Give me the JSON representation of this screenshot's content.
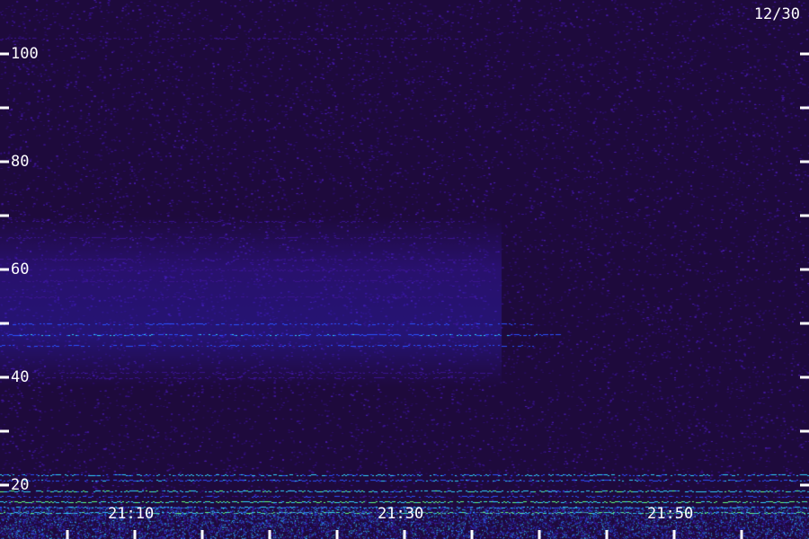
{
  "date_label": "12/30",
  "chart_data": {
    "type": "heatmap",
    "title": "",
    "xlabel": "",
    "ylabel": "",
    "x_ticks": [
      "21:10",
      "21:30",
      "21:50"
    ],
    "y_ticks": [
      20,
      40,
      60,
      80,
      100
    ],
    "y_minor_ticks": [
      30,
      50,
      70,
      90
    ],
    "ylim": [
      14,
      107
    ],
    "xlim": [
      "21:00",
      "22:00"
    ],
    "bands": [
      {
        "y": 103,
        "intensity": 0.35
      },
      {
        "y": 69,
        "intensity": 0.35
      },
      {
        "y": 66,
        "intensity": 0.35
      },
      {
        "y": 62,
        "intensity": 0.4
      },
      {
        "y": 60,
        "intensity": 0.45
      },
      {
        "y": 58,
        "intensity": 0.45
      },
      {
        "y": 55,
        "intensity": 0.4
      },
      {
        "y": 50,
        "intensity": 0.6
      },
      {
        "y": 48,
        "intensity": 0.7
      },
      {
        "y": 46,
        "intensity": 0.6
      },
      {
        "y": 41,
        "intensity": 0.45
      },
      {
        "y": 40,
        "intensity": 0.4
      },
      {
        "y": 22,
        "intensity": 0.8
      },
      {
        "y": 21,
        "intensity": 0.7
      },
      {
        "y": 19,
        "intensity": 0.9
      },
      {
        "y": 18,
        "intensity": 0.6
      },
      {
        "y": 17,
        "intensity": 1.0
      },
      {
        "y": 16,
        "intensity": 0.8
      },
      {
        "y": 15,
        "intensity": 1.0
      }
    ],
    "colors": {
      "background": "#1e0a3c",
      "low": "#3a1490",
      "mid": "#2a50ff",
      "high": "#30d0ff",
      "peak": "#60ff80",
      "text": "#ffffff"
    }
  }
}
